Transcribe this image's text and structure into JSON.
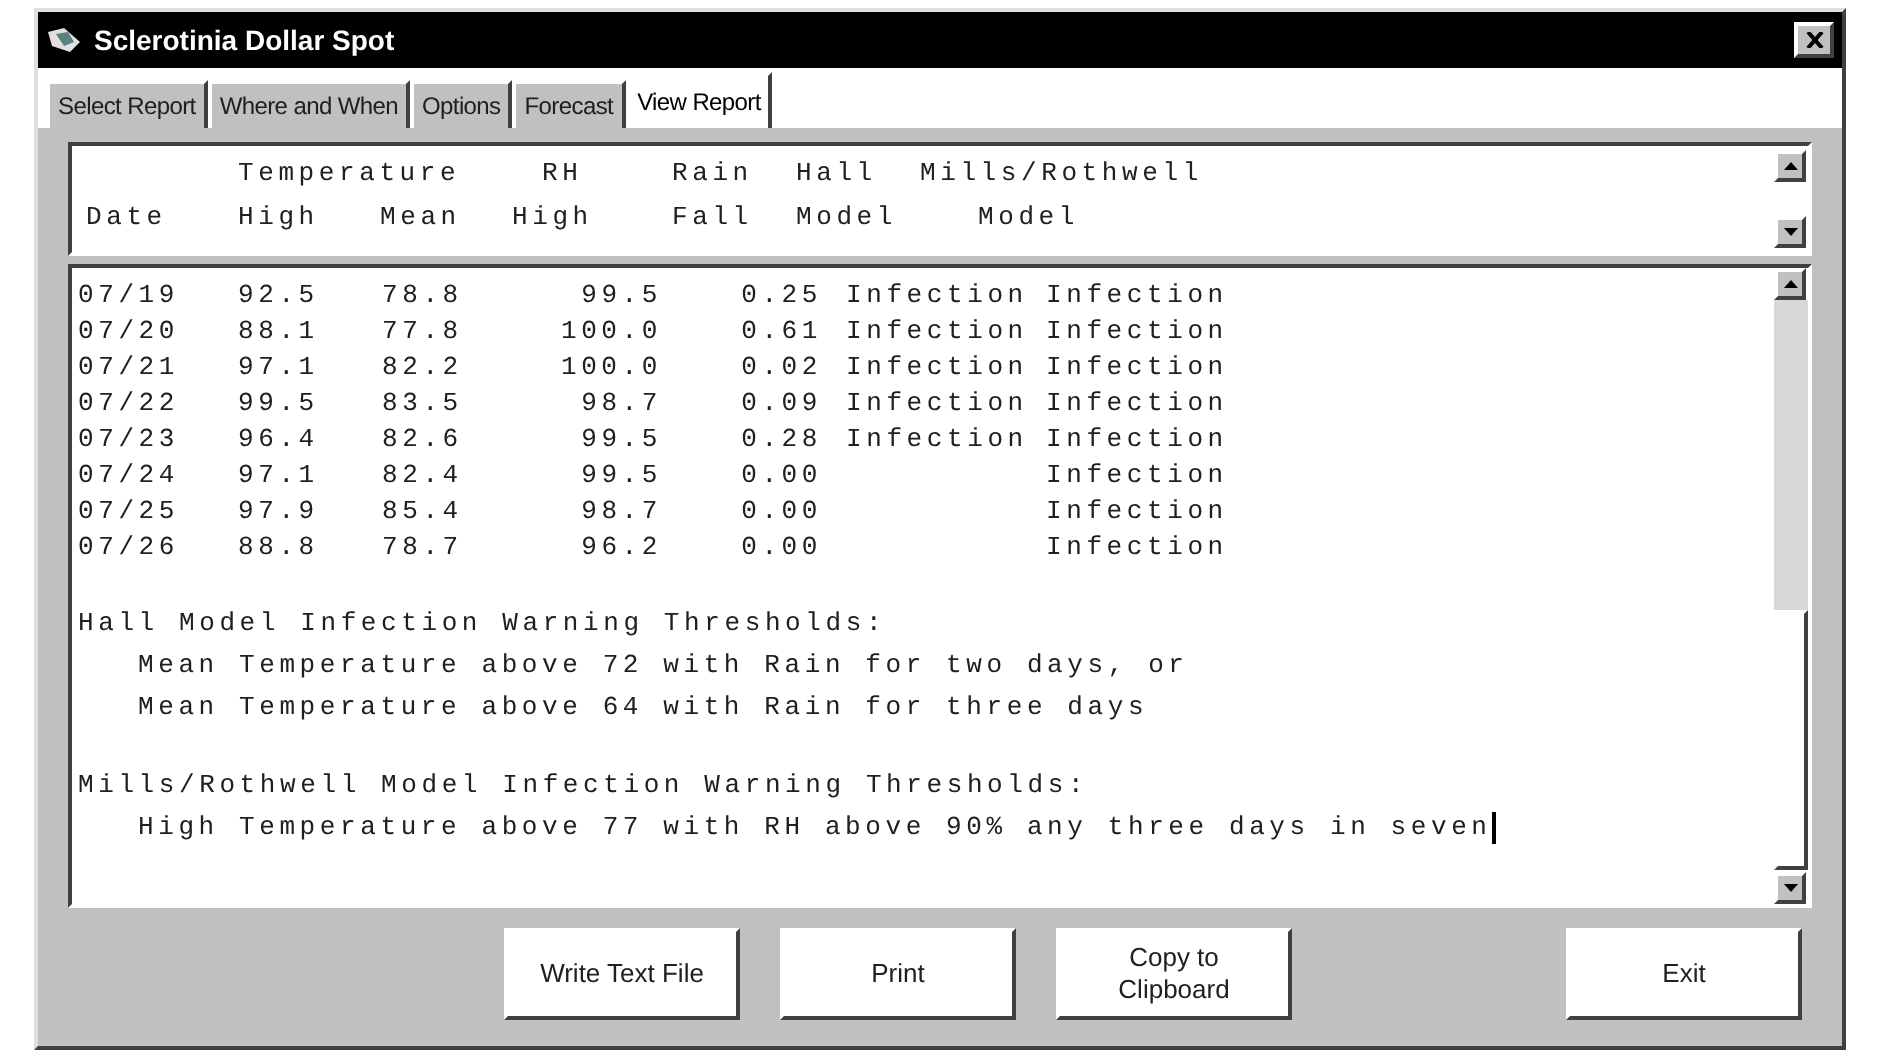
{
  "window": {
    "title": "Sclerotinia Dollar Spot"
  },
  "tabs": [
    {
      "label": "Select Report",
      "selected": false
    },
    {
      "label": "Where and When",
      "selected": false
    },
    {
      "label": "Options",
      "selected": false
    },
    {
      "label": "Forecast",
      "selected": false
    },
    {
      "label": "View Report",
      "selected": true
    }
  ],
  "report": {
    "header": {
      "top": [
        "Temperature",
        "RH",
        "Rain",
        "Hall",
        "Mills/Rothwell"
      ],
      "bottom": [
        "Date",
        "High",
        "Mean",
        "High",
        "Fall",
        "Model",
        "Model"
      ]
    },
    "rows": [
      {
        "date": "07/19",
        "high": "92.5",
        "mean": "78.8",
        "rh": "99.5",
        "rain": "0.25",
        "hall": "Infection",
        "mills": "Infection"
      },
      {
        "date": "07/20",
        "high": "88.1",
        "mean": "77.8",
        "rh": "100.0",
        "rain": "0.61",
        "hall": "Infection",
        "mills": "Infection"
      },
      {
        "date": "07/21",
        "high": "97.1",
        "mean": "82.2",
        "rh": "100.0",
        "rain": "0.02",
        "hall": "Infection",
        "mills": "Infection"
      },
      {
        "date": "07/22",
        "high": "99.5",
        "mean": "83.5",
        "rh": "98.7",
        "rain": "0.09",
        "hall": "Infection",
        "mills": "Infection"
      },
      {
        "date": "07/23",
        "high": "96.4",
        "mean": "82.6",
        "rh": "99.5",
        "rain": "0.28",
        "hall": "Infection",
        "mills": "Infection"
      },
      {
        "date": "07/24",
        "high": "97.1",
        "mean": "82.4",
        "rh": "99.5",
        "rain": "0.00",
        "mills": "Infection"
      },
      {
        "date": "07/25",
        "high": "97.9",
        "mean": "85.4",
        "rh": "98.7",
        "rain": "0.00",
        "mills": "Infection"
      },
      {
        "date": "07/26",
        "high": "88.8",
        "mean": "78.7",
        "rh": "96.2",
        "rain": "0.00",
        "mills": "Infection"
      }
    ],
    "notes": [
      {
        "heading": "Hall Model Infection Warning Thresholds:",
        "lines": [
          "Mean Temperature above 72 with Rain for two days, or",
          "Mean Temperature above 64 with Rain for three days"
        ]
      },
      {
        "heading": "Mills/Rothwell Model Infection Warning Thresholds:",
        "lines": [
          "High Temperature above 77 with RH above 90% any three days in seven"
        ]
      }
    ]
  },
  "buttons": [
    "Write Text File",
    "Print",
    "Copy to Clipboard",
    "Exit"
  ]
}
